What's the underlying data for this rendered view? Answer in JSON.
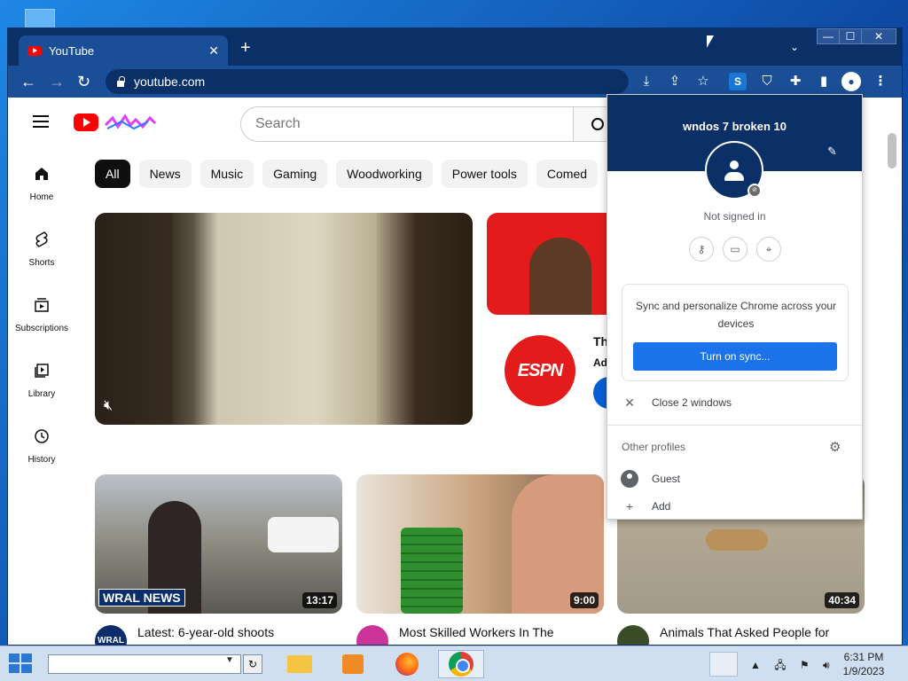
{
  "browser": {
    "tab_title": "YouTube",
    "tab_close": "✕",
    "new_tab": "+",
    "tab_menu": "⌄",
    "url": "youtube.com",
    "window_controls": {
      "minimize": "—",
      "maximize": "☐",
      "close": "✕"
    }
  },
  "youtube": {
    "search_placeholder": "Search",
    "chips": [
      "All",
      "News",
      "Music",
      "Gaming",
      "Woodworking",
      "Power tools",
      "Comed"
    ],
    "guide": [
      {
        "label": "Home"
      },
      {
        "label": "Shorts"
      },
      {
        "label": "Subscriptions"
      },
      {
        "label": "Library"
      },
      {
        "label": "History"
      }
    ],
    "ad": {
      "logo": "ESPN",
      "title_partial": "Th",
      "sub_partial": "Ad"
    },
    "videos": [
      {
        "title": "Latest: 6-year-old shoots",
        "duration": "13:17",
        "channel_badge": "WRAL",
        "overlay": "WRAL NEWS"
      },
      {
        "title": "Most Skilled Workers In The",
        "duration": "9:00"
      },
      {
        "title": "Animals That Asked People for",
        "duration": "40:34"
      }
    ]
  },
  "profile_panel": {
    "name": "wndos 7  broken 10",
    "status": "Not signed in",
    "sync_text": "Sync and personalize Chrome across your devices",
    "sync_button": "Turn on sync...",
    "close_windows": "Close 2 windows",
    "other_profiles": "Other profiles",
    "guest": "Guest",
    "add": "Add"
  },
  "taskbar": {
    "time": "6:31 PM",
    "date": "1/9/2023"
  }
}
